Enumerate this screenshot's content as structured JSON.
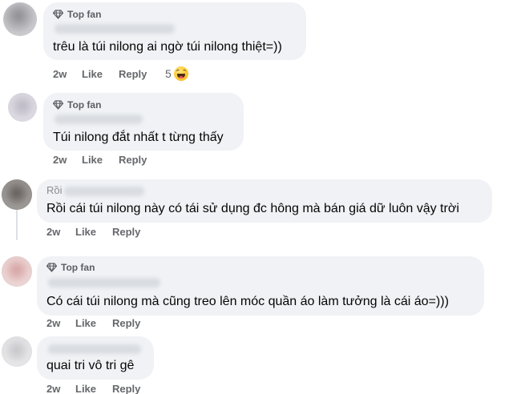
{
  "comments": [
    {
      "badge": "Top fan",
      "text": "trêu là túi nilong ai ngờ túi nilong thiệt=))",
      "time": "2w",
      "like": "Like",
      "reply": "Reply",
      "reaction_count": "5",
      "reaction_icon": "haha-reaction-icon"
    },
    {
      "badge": "Top fan",
      "text": "Túi nilong đắt nhất t từng thấy",
      "time": "2w",
      "like": "Like",
      "reply": "Reply"
    },
    {
      "name_partial": "Rồi",
      "text": "Rồi cái túi nilong này có tái sử dụng đc hông mà bán giá dữ luôn vậy trời",
      "time": "2w",
      "like": "Like",
      "reply": "Reply"
    },
    {
      "badge": "Top fan",
      "text": "Có cái túi nilong mà cũng treo lên móc quần áo làm tưởng là cái áo=)))",
      "time": "2w",
      "like": "Like",
      "reply": "Reply"
    },
    {
      "text": "quai tri vô tri gê",
      "time": "2w",
      "like": "Like",
      "reply": "Reply"
    }
  ],
  "colors": {
    "bubble": "#f0f2f5",
    "meta_text": "#65676b",
    "body_text": "#050505"
  }
}
